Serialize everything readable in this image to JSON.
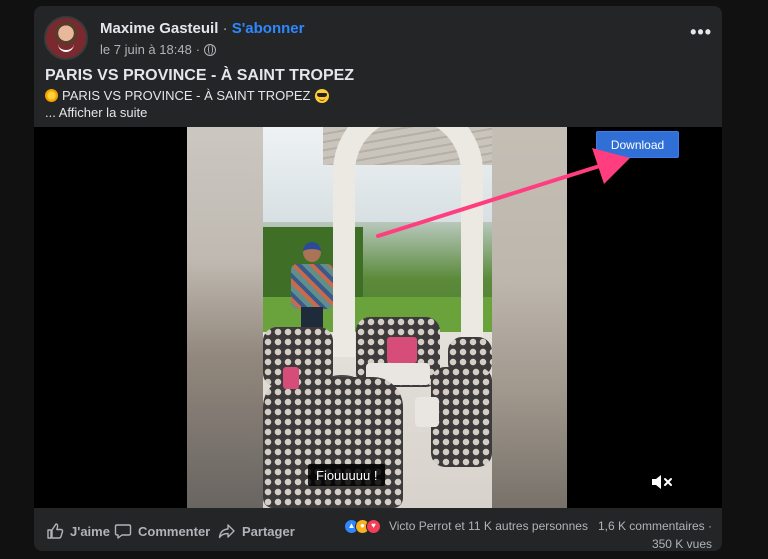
{
  "post": {
    "author": "Maxime Gasteuil",
    "separator": "·",
    "follow_label": "S'abonner",
    "date": "le 7 juin à 18:48",
    "more_label": "•••",
    "title": "PARIS VS PROVINCE - À SAINT TROPEZ",
    "description": "PARIS VS PROVINCE - À SAINT TROPEZ",
    "see_more": "... Afficher la suite"
  },
  "video": {
    "download_label": "Download",
    "subtitle": "Fiouuuuu !",
    "arrow_color": "#ff3d7f",
    "button_color": "#2f6fd6"
  },
  "footer": {
    "like_label": "J'aime",
    "comment_label": "Commenter",
    "share_label": "Partager",
    "reactions_text": "Victo Perrot et 11 K autres personnes",
    "comments_count": "1,6 K commentaires ·",
    "views": "350 K vues"
  },
  "icons": [
    "avatar",
    "globe-icon",
    "more-icon",
    "sun-emoji-icon",
    "sunglasses-emoji-icon",
    "mute-icon",
    "like-icon",
    "comment-icon",
    "share-icon",
    "like-reaction-icon",
    "haha-reaction-icon",
    "love-reaction-icon"
  ]
}
